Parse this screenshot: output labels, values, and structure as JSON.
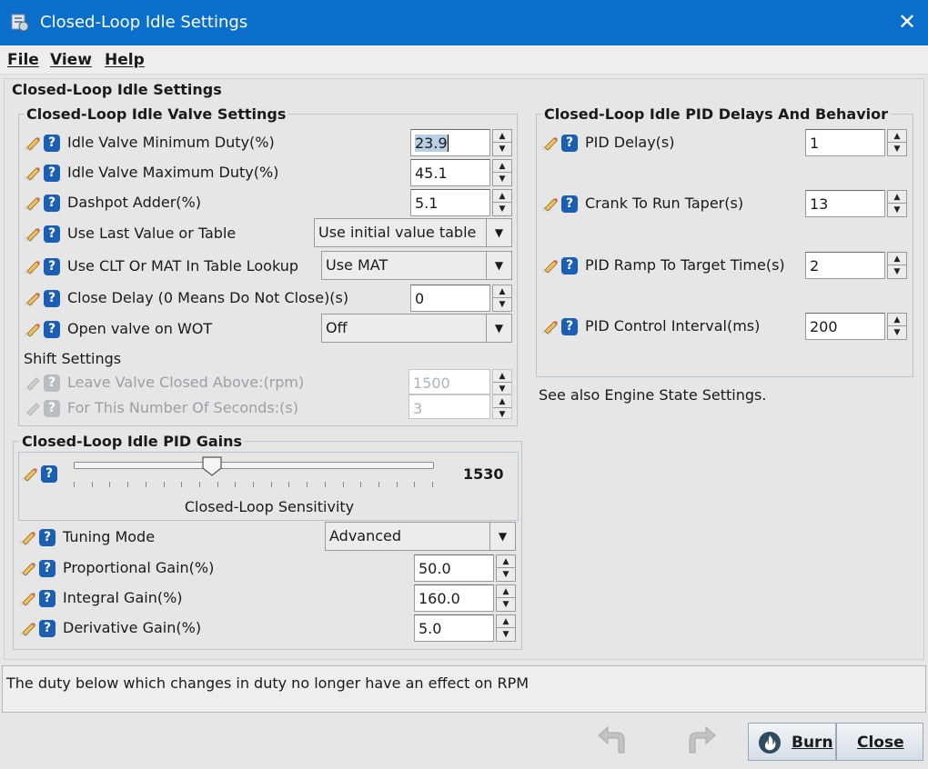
{
  "window": {
    "title": "Closed-Loop Idle Settings",
    "close_symbol": "✕"
  },
  "menu": {
    "file": "File",
    "view": "View",
    "help": "Help"
  },
  "outer_title": "Closed-Loop Idle Settings",
  "valve": {
    "title": "Closed-Loop Idle Valve Settings",
    "min_duty": {
      "label": "Idle Valve Minimum Duty(%)",
      "value": "23.9"
    },
    "max_duty": {
      "label": "Idle Valve Maximum Duty(%)",
      "value": "45.1"
    },
    "dashpot": {
      "label": "Dashpot Adder(%)",
      "value": "5.1"
    },
    "last_value": {
      "label": "Use Last Value or Table",
      "value": "Use initial value table"
    },
    "clt_mat": {
      "label": "Use CLT Or MAT In Table Lookup",
      "value": "Use MAT"
    },
    "close_delay": {
      "label": "Close Delay (0 Means Do Not Close)(s)",
      "value": "0"
    },
    "open_wot": {
      "label": "Open valve on WOT",
      "value": "Off"
    },
    "shift_title": "Shift Settings",
    "leave_closed": {
      "label": "Leave Valve Closed Above:(rpm)",
      "value": "1500"
    },
    "num_seconds": {
      "label": "For This Number Of Seconds:(s)",
      "value": "3"
    }
  },
  "gains": {
    "title": "Closed-Loop Idle PID Gains",
    "sensitivity": {
      "caption": "Closed-Loop Sensitivity",
      "value": "1530",
      "fraction": 0.385
    },
    "tuning_mode": {
      "label": "Tuning Mode",
      "value": "Advanced"
    },
    "proportional": {
      "label": "Proportional Gain(%)",
      "value": "50.0"
    },
    "integral": {
      "label": "Integral Gain(%)",
      "value": "160.0"
    },
    "derivative": {
      "label": "Derivative Gain(%)",
      "value": "5.0"
    }
  },
  "pid": {
    "title": "Closed-Loop Idle PID Delays And Behavior",
    "delay": {
      "label": "PID Delay(s)",
      "value": "1"
    },
    "crank_taper": {
      "label": "Crank To Run Taper(s)",
      "value": "13"
    },
    "ramp": {
      "label": "PID Ramp To Target Time(s)",
      "value": "2"
    },
    "interval": {
      "label": "PID Control Interval(ms)",
      "value": "200"
    },
    "see_also": "See also Engine State Settings."
  },
  "status_text": "The duty below which changes in duty no longer have an effect on RPM",
  "buttons": {
    "burn": "Burn",
    "close": "Close"
  },
  "colors": {
    "titlebar": "#0a6fcb",
    "help_icon": "#1b5fb5",
    "burn_icon": "#2f4a63"
  }
}
